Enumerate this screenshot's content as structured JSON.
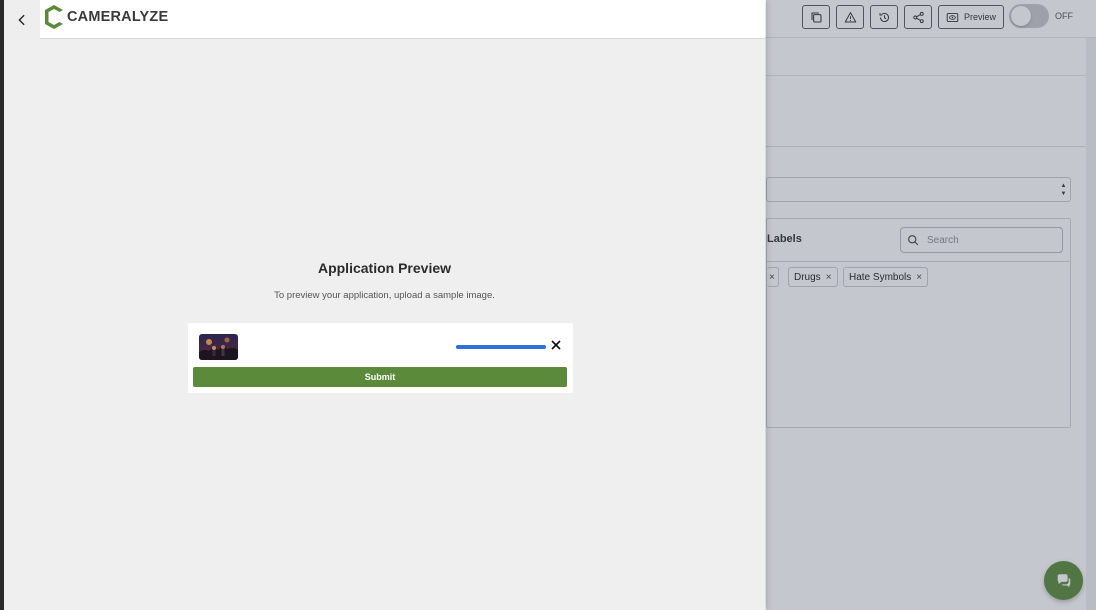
{
  "app": {
    "logo_text": "CAMERALYZE"
  },
  "toolbar": {
    "preview_label": "Preview",
    "toggle_label": "OFF"
  },
  "background_panel": {
    "labels_title": "Labels",
    "search_placeholder": "Search",
    "chips": [
      "Drugs",
      "Hate Symbols"
    ]
  },
  "preview": {
    "title": "Application Preview",
    "subtitle": "To preview your application, upload a sample image.",
    "upload_progress_percent": 100,
    "submit_label": "Submit"
  },
  "colors": {
    "brand_green": "#5b8a3a",
    "progress_blue": "#2f6fd6"
  },
  "icons": {
    "back": "chevron-left-icon",
    "copy": "copy-icon",
    "warning": "warning-icon",
    "history": "history-icon",
    "share": "share-icon",
    "preview": "eye-icon",
    "close": "close-icon",
    "search": "search-icon",
    "chat": "chat-icon"
  }
}
